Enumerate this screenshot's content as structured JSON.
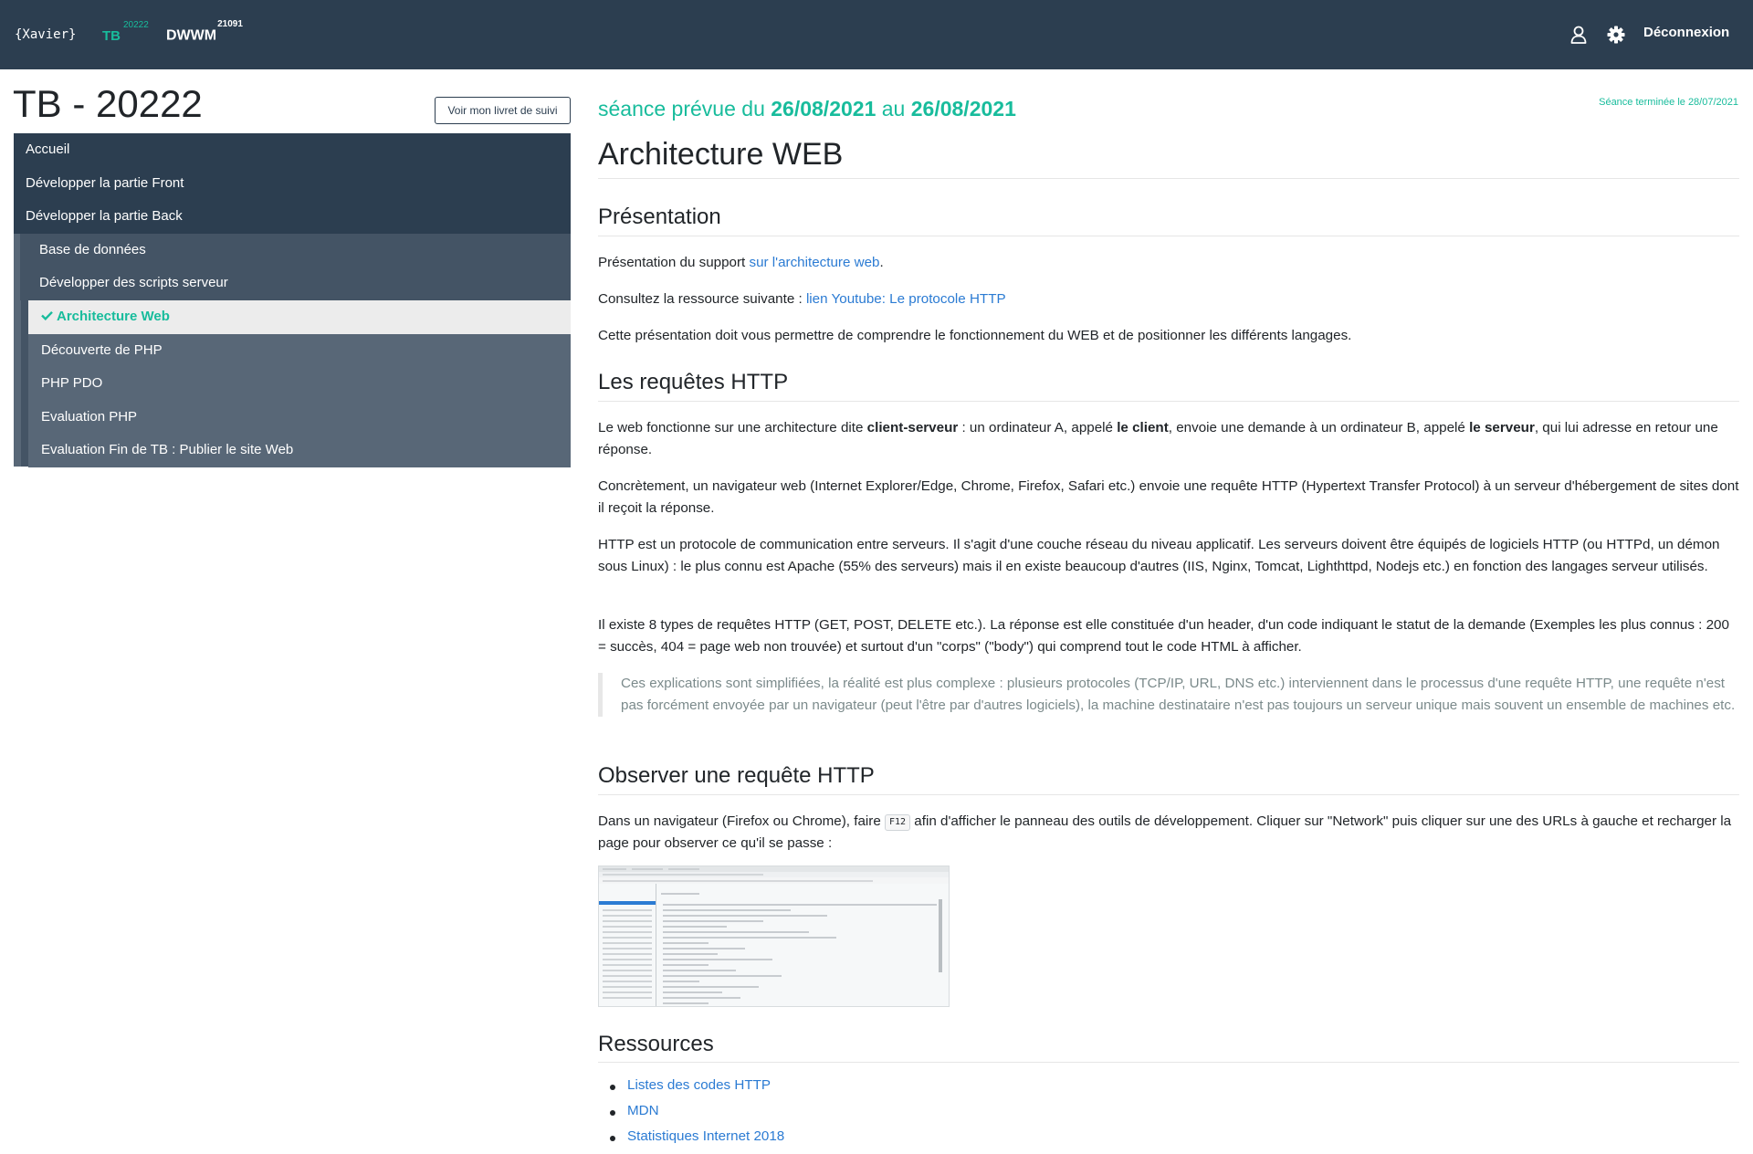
{
  "navbar": {
    "brand": "{Xavier}",
    "tb_label": "TB",
    "tb_number": "20222",
    "dwwm_label": "DWWM",
    "dwwm_number": "21091",
    "user_icon": "user-icon",
    "settings_icon": "gear-icon",
    "logout_label": "Déconnexion"
  },
  "sidebar": {
    "title": "TB - 20222",
    "livret_button": "Voir mon livret de suivi",
    "items": [
      {
        "label": "Accueil",
        "level": 1
      },
      {
        "label": "Développer la partie Front",
        "level": 1
      },
      {
        "label": "Développer la partie Back",
        "level": 1
      },
      {
        "label": "Base de données",
        "level": 2
      },
      {
        "label": "Développer des scripts serveur",
        "level": 2
      },
      {
        "label": "Architecture Web",
        "level": 3,
        "active": true
      },
      {
        "label": "Découverte de PHP",
        "level": 3
      },
      {
        "label": "PHP PDO",
        "level": 3
      },
      {
        "label": "Evaluation PHP",
        "level": 3
      },
      {
        "label": "Evaluation Fin de TB : Publier le site Web",
        "level": 3
      }
    ]
  },
  "content": {
    "schedule_prefix": "séance prévue du ",
    "schedule_start": "26/08/2021",
    "schedule_mid": " au ",
    "schedule_end": "26/08/2021",
    "done_label": "Séance terminée le 28/07/2021",
    "title": "Architecture WEB",
    "sections": {
      "presentation": {
        "heading": "Présentation",
        "p1_text": "Présentation du support ",
        "p1_link": "sur l'architecture web",
        "p1_end": ".",
        "p2_text": "Consultez la ressource suivante : ",
        "p2_link": "lien Youtube: Le protocole HTTP",
        "p3": "Cette présentation doit vous permettre de comprendre le fonctionnement du WEB et de positionner les différents langages."
      },
      "requetes": {
        "heading": "Les requêtes HTTP",
        "p1_a": "Le web fonctionne sur une architecture dite ",
        "p1_b": "client-serveur",
        "p1_c": " : un ordinateur A, appelé ",
        "p1_d": "le client",
        "p1_e": ", envoie une demande à un ordinateur B, appelé ",
        "p1_f": "le serveur",
        "p1_g": ", qui lui adresse en retour une réponse.",
        "p2": "Concrètement, un navigateur web (Internet Explorer/Edge, Chrome, Firefox, Safari etc.) envoie une requête HTTP (Hypertext Transfer Protocol) à un serveur d'hébergement de sites dont il reçoit la réponse.",
        "p3": "HTTP est un protocole de communication entre serveurs. Il s'agit d'une couche réseau du niveau applicatif. Les serveurs doivent être équipés de logiciels HTTP (ou HTTPd, un démon sous Linux) : le plus connu est Apache (55% des serveurs) mais il en existe beaucoup d'autres (IIS, Nginx, Tomcat, Lighthttpd, Nodejs etc.) en fonction des langages serveur utilisés.",
        "p4": "Il existe 8 types de requêtes HTTP (GET, POST, DELETE etc.). La réponse est elle constituée d'un header, d'un code indiquant le statut de la demande (Exemples les plus connus : 200 = succès, 404 = page web non trouvée) et surtout d'un \"corps\" (\"body\") qui comprend tout le code HTML à afficher.",
        "quote": "Ces explications sont simplifiées, la réalité est plus complexe : plusieurs protocoles (TCP/IP, URL, DNS etc.) interviennent dans le processus d'une requête HTTP, une requête n'est pas forcément envoyée par un navigateur (peut l'être par d'autres logiciels), la machine destinataire n'est pas toujours un serveur unique mais souvent un ensemble de machines etc."
      },
      "observer": {
        "heading": "Observer une requête HTTP",
        "p1_a": "Dans un navigateur (Firefox ou Chrome), faire ",
        "p1_kbd": "F12",
        "p1_b": " afin d'afficher le panneau des outils de développement. Cliquer sur \"Network\" puis cliquer sur une des URLs à gauche et recharger la page pour observer ce qu'il se passe :"
      },
      "ressources": {
        "heading": "Ressources",
        "links": [
          "Listes des codes HTTP",
          "MDN",
          "Statistiques Internet 2018"
        ]
      }
    }
  }
}
